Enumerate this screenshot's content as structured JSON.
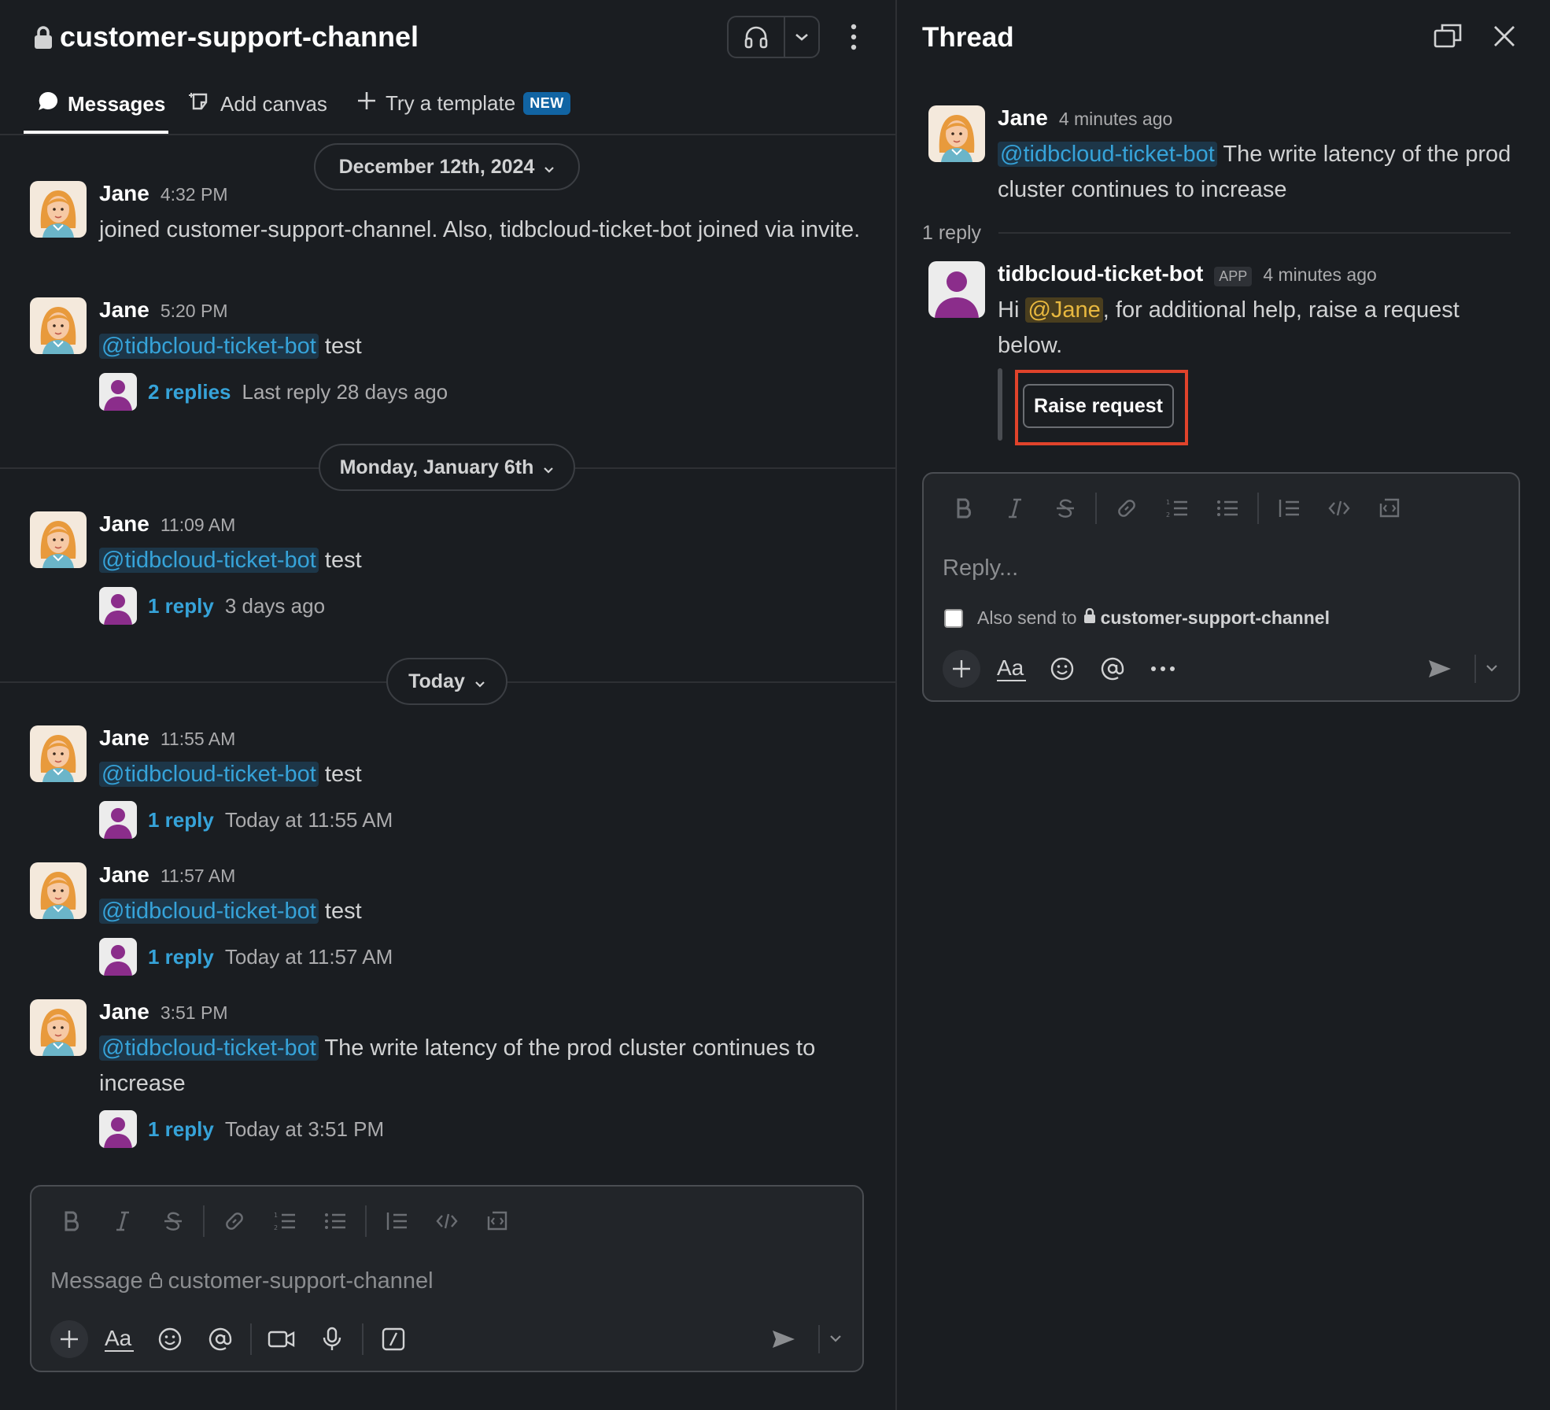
{
  "channel": {
    "name": "customer-support-channel",
    "tabs": [
      {
        "label": "Messages"
      },
      {
        "label": "Add canvas"
      },
      {
        "label": "Try a template"
      }
    ],
    "new_badge": "NEW",
    "date_separators": [
      "December 12th, 2024",
      "Monday, January 6th",
      "Today"
    ],
    "messages": [
      {
        "author": "Jane",
        "time": "4:32 PM",
        "text": "joined customer-support-channel. Also, tidbcloud-ticket-bot joined via invite."
      },
      {
        "author": "Jane",
        "time": "5:20 PM",
        "mention": "@tidbcloud-ticket-bot",
        "text": " test",
        "reply_count": "2 replies",
        "reply_meta": "Last reply 28 days ago"
      },
      {
        "author": "Jane",
        "time": "11:09 AM",
        "mention": "@tidbcloud-ticket-bot",
        "text": " test",
        "reply_count": "1 reply",
        "reply_meta": "3 days ago"
      },
      {
        "author": "Jane",
        "time": "11:55 AM",
        "mention": "@tidbcloud-ticket-bot",
        "text": " test",
        "reply_count": "1 reply",
        "reply_meta": "Today at 11:55 AM"
      },
      {
        "author": "Jane",
        "time": "11:57 AM",
        "mention": "@tidbcloud-ticket-bot",
        "text": " test",
        "reply_count": "1 reply",
        "reply_meta": "Today at 11:57 AM"
      },
      {
        "author": "Jane",
        "time": "3:51 PM",
        "mention": "@tidbcloud-ticket-bot",
        "text": " The write latency of the prod cluster continues to increase",
        "reply_count": "1 reply",
        "reply_meta": "Today at 3:51 PM"
      }
    ],
    "composer": {
      "placeholder_prefix": "Message",
      "placeholder_channel": "customer-support-channel"
    }
  },
  "thread": {
    "title": "Thread",
    "parent": {
      "author": "Jane",
      "time": "4 minutes ago",
      "mention": "@tidbcloud-ticket-bot",
      "text": " The write latency of the prod cluster continues to increase"
    },
    "reply_divider": "1 reply",
    "bot_reply": {
      "author": "tidbcloud-ticket-bot",
      "badge": "APP",
      "time": "4 minutes ago",
      "text_before": "Hi ",
      "mention": "@Jane",
      "text_after": ", for additional help, raise a request below.",
      "button": "Raise request"
    },
    "composer": {
      "placeholder": "Reply...",
      "also_send_label": "Also send to",
      "also_send_channel": "customer-support-channel"
    }
  },
  "colors": {
    "background": "#1a1d21",
    "mention": "#36a3d9",
    "self_mention": "#e8b83f",
    "highlight": "#e0432b",
    "badge_new": "#1164a3"
  },
  "icons": [
    "lock-icon",
    "headphones-icon",
    "chevron-down-icon",
    "kebab-icon",
    "chat-bubble-icon",
    "canvas-icon",
    "plus-icon",
    "popout-icon",
    "close-icon",
    "bold-icon",
    "italic-icon",
    "strikethrough-icon",
    "link-icon",
    "ordered-list-icon",
    "bullet-list-icon",
    "blockquote-icon",
    "code-icon",
    "code-block-icon",
    "text-format-icon",
    "emoji-icon",
    "mention-icon",
    "more-icon",
    "video-icon",
    "microphone-icon",
    "slash-command-icon",
    "send-icon"
  ]
}
